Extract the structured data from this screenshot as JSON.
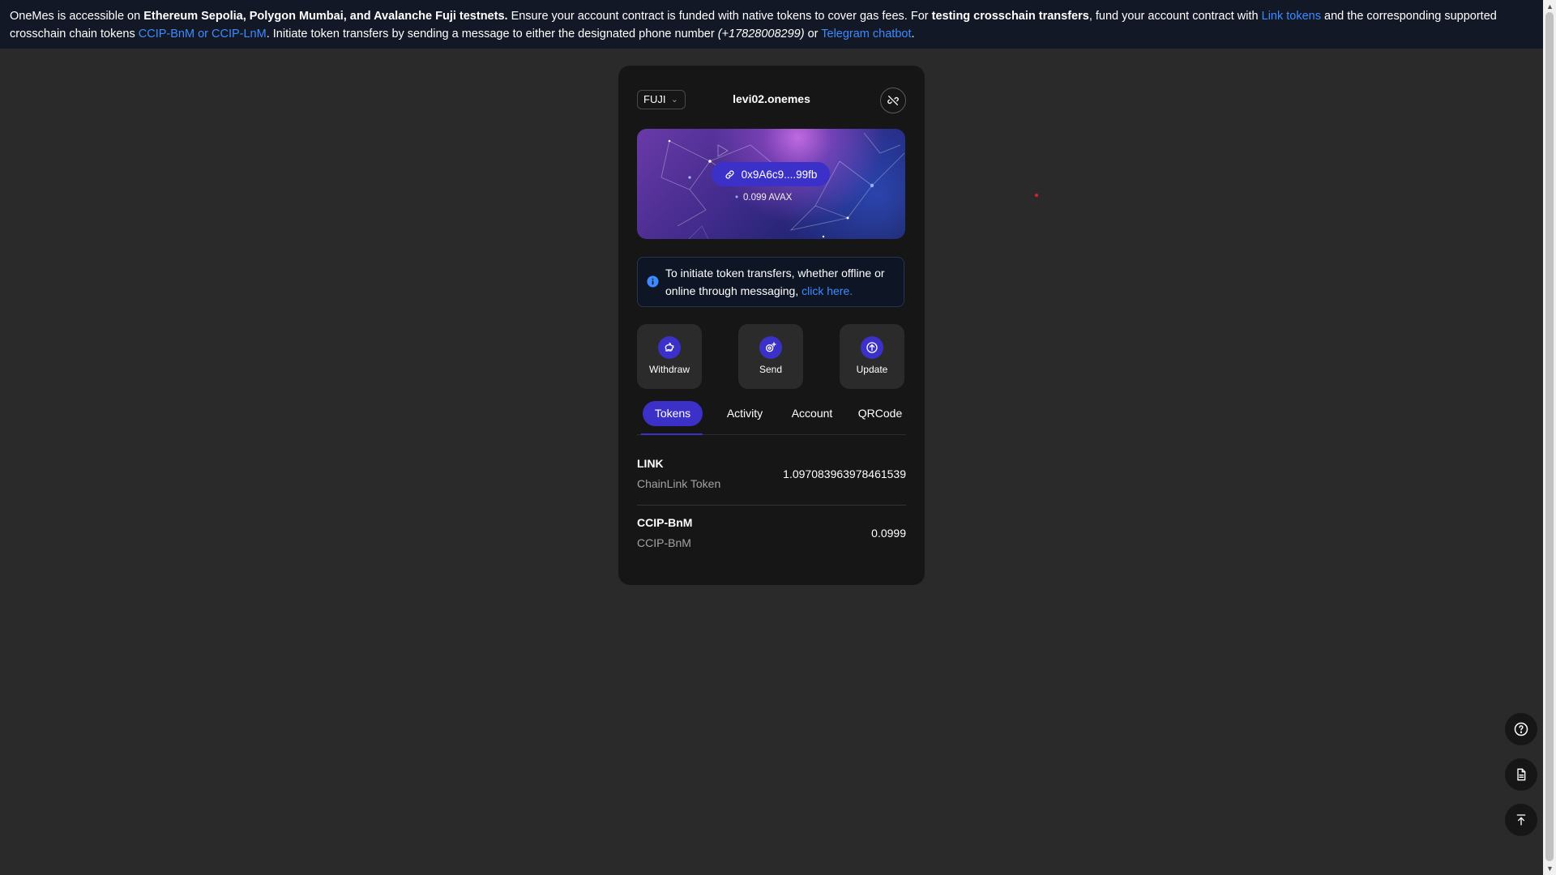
{
  "banner": {
    "t1": "OneMes is accessible on ",
    "b1": "Ethereum Sepolia, Polygon Mumbai, and Avalanche Fuji testnets.",
    "t2": " Ensure your account contract is funded with native tokens to cover gas fees. For ",
    "b2": "testing crosschain transfers",
    "t3": ", fund your account contract with ",
    "link1": "Link tokens",
    "t4": " and the corresponding supported crosschain chain tokens ",
    "link2": "CCIP-BnM or CCIP-LnM",
    "t5": ". Initiate token transfers by sending a message to either the designated phone number ",
    "phone": "(+17828008299)",
    "t6": " or ",
    "link3": "Telegram chatbot",
    "t7": "."
  },
  "wallet": {
    "network": "FUJI",
    "account_name": "levi02.onemes",
    "address": "0x9A6c9....99fb",
    "balance": "0.099 AVAX",
    "info_text": "To initiate token transfers, whether offline or online through messaging, ",
    "info_link": "click here.",
    "actions": {
      "withdraw": "Withdraw",
      "send": "Send",
      "update": "Update"
    },
    "tabs": [
      "Tokens",
      "Activity",
      "Account",
      "QRCode"
    ],
    "active_tab": "Tokens",
    "tokens": [
      {
        "symbol": "LINK",
        "name": "ChainLink Token",
        "amount": "1.097083963978461539"
      },
      {
        "symbol": "CCIP-BnM",
        "name": "CCIP-BnM",
        "amount": "0.0999"
      }
    ]
  },
  "floating_buttons": [
    "help-icon",
    "document-icon",
    "scroll-top-icon"
  ],
  "colors": {
    "accent": "#3b30c8",
    "link": "#3d8bff",
    "banner_bg": "#121826",
    "page_bg": "#2a2a2a"
  }
}
